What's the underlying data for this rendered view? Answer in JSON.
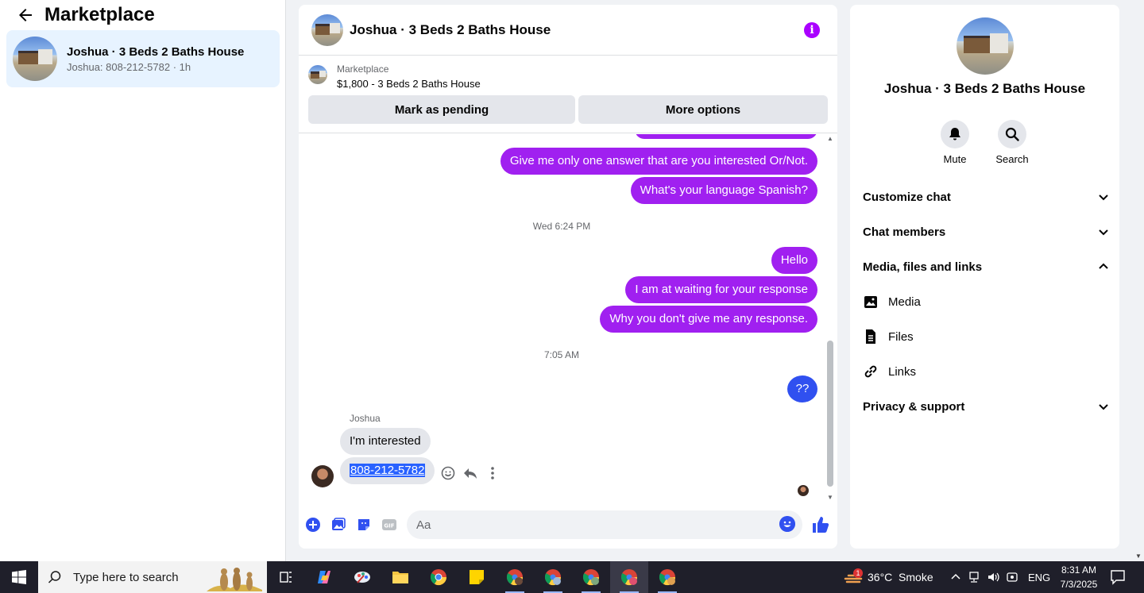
{
  "left_panel": {
    "title": "Marketplace",
    "conversation": {
      "title": "Joshua · 3 Beds 2 Baths House",
      "subtitle": "Joshua: 808-212-5782 · 1h"
    }
  },
  "chat": {
    "header_title": "Joshua · 3 Beds 2 Baths House",
    "listing": {
      "label": "Marketplace",
      "price_title": "$1,800 - 3 Beds 2 Baths House",
      "mark_pending": "Mark as pending",
      "more_options": "More options"
    },
    "messages": {
      "out1": "Give me only one answer that are you interested Or/Not.",
      "out2": "What's your language Spanish?",
      "time1": "Wed 6:24 PM",
      "out3": "Hello",
      "out4": "I am at waiting for your response",
      "out5": "Why you don't give me any response.",
      "time2": "7:05 AM",
      "out6": "??",
      "sender": "Joshua",
      "in1": "I'm interested",
      "in2": "808-212-5782"
    },
    "composer_placeholder": "Aa",
    "colors": {
      "outgoing": "#a020f0",
      "outgoing_alt": "#3050f0",
      "accent": "#a0f"
    }
  },
  "right_panel": {
    "title": "Joshua · 3 Beds 2 Baths House",
    "actions": {
      "mute": "Mute",
      "search": "Search"
    },
    "sections": {
      "customize": "Customize chat",
      "members": "Chat members",
      "media_files": "Media, files and links",
      "media": "Media",
      "files": "Files",
      "links": "Links",
      "privacy": "Privacy & support"
    }
  },
  "taskbar": {
    "search_placeholder": "Type here to search",
    "weather": "36°C  Smoke",
    "weather_badge": "1",
    "language": "ENG",
    "time": "8:31 AM",
    "date": "7/3/2025"
  }
}
